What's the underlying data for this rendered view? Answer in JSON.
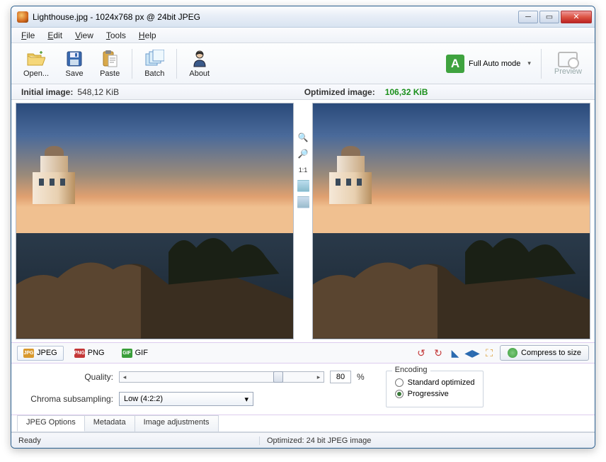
{
  "window": {
    "title": "Lighthouse.jpg - 1024x768 px @ 24bit JPEG"
  },
  "menu": {
    "file": "File",
    "edit": "Edit",
    "view": "View",
    "tools": "Tools",
    "help": "Help"
  },
  "toolbar": {
    "open": "Open...",
    "save": "Save",
    "paste": "Paste",
    "batch": "Batch",
    "about": "About",
    "auto": "Full Auto mode",
    "preview": "Preview"
  },
  "sizes": {
    "initial_label": "Initial image:",
    "initial_value": "548,12 KiB",
    "optimized_label": "Optimized image:",
    "optimized_value": "106,32 KiB"
  },
  "midtools": {
    "ratio": "1:1"
  },
  "formats": {
    "jpeg": "JPEG",
    "png": "PNG",
    "gif": "GIF",
    "compress": "Compress to size"
  },
  "options": {
    "quality_label": "Quality:",
    "quality_value": "80",
    "percent": "%",
    "chroma_label": "Chroma subsampling:",
    "chroma_value": "Low (4:2:2)",
    "encoding_title": "Encoding",
    "standard": "Standard optimized",
    "progressive": "Progressive"
  },
  "tabs": {
    "jpeg_options": "JPEG Options",
    "metadata": "Metadata",
    "adjustments": "Image adjustments"
  },
  "status": {
    "ready": "Ready",
    "optimized": "Optimized: 24 bit JPEG image"
  }
}
